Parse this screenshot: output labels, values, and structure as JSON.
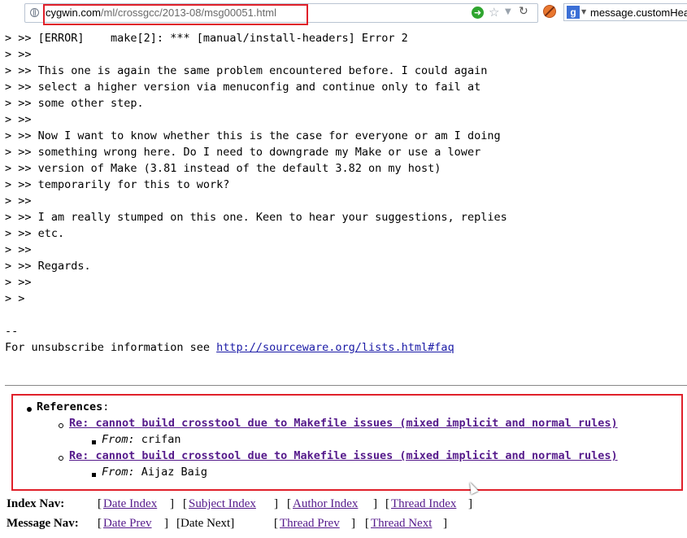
{
  "browser": {
    "url_domain": "cygwin.com",
    "url_path": "/ml/crossgcc/2013-08/msg00051.html",
    "search_text": "message.customHea"
  },
  "message": {
    "quoted_lines": [
      "> >> [ERROR]    make[2]: *** [manual/install-headers] Error 2",
      "> >>",
      "> >> This one is again the same problem encountered before. I could again",
      "> >> select a higher version via menuconfig and continue only to fail at",
      "> >> some other step.",
      "> >>",
      "> >> Now I want to know whether this is the case for everyone or am I doing",
      "> >> something wrong here. Do I need to downgrade my Make or use a lower",
      "> >> version of Make (3.81 instead of the default 3.82 on my host)",
      "> >> temporarily for this to work?",
      "> >>",
      "> >> I am really stumped on this one. Keen to hear your suggestions, replies",
      "> >> etc.",
      "> >>",
      "> >> Regards.",
      "> >>",
      "> >"
    ],
    "sig_dash": "--",
    "unsubscribe_text": "For unsubscribe information see ",
    "unsubscribe_link": "http://sourceware.org/lists.html#faq"
  },
  "references": {
    "title": "References",
    "colon": ":",
    "items": [
      {
        "subject": "Re: cannot build crosstool due to Makefile issues (mixed implicit and normal rules)",
        "from_label": "From:",
        "from_name": "crifan"
      },
      {
        "subject": "Re: cannot build crosstool due to Makefile issues (mixed implicit and normal rules)",
        "from_label": "From:",
        "from_name": "Aijaz Baig"
      }
    ]
  },
  "nav": {
    "index_label": "Index Nav:",
    "index_links": [
      "Date Index",
      "Subject Index",
      "Author Index",
      "Thread Index"
    ],
    "message_label": "Message Nav:",
    "date_prev": "Date Prev",
    "date_next": "Date Next",
    "thread_prev": "Thread Prev",
    "thread_next": "Thread Next"
  }
}
